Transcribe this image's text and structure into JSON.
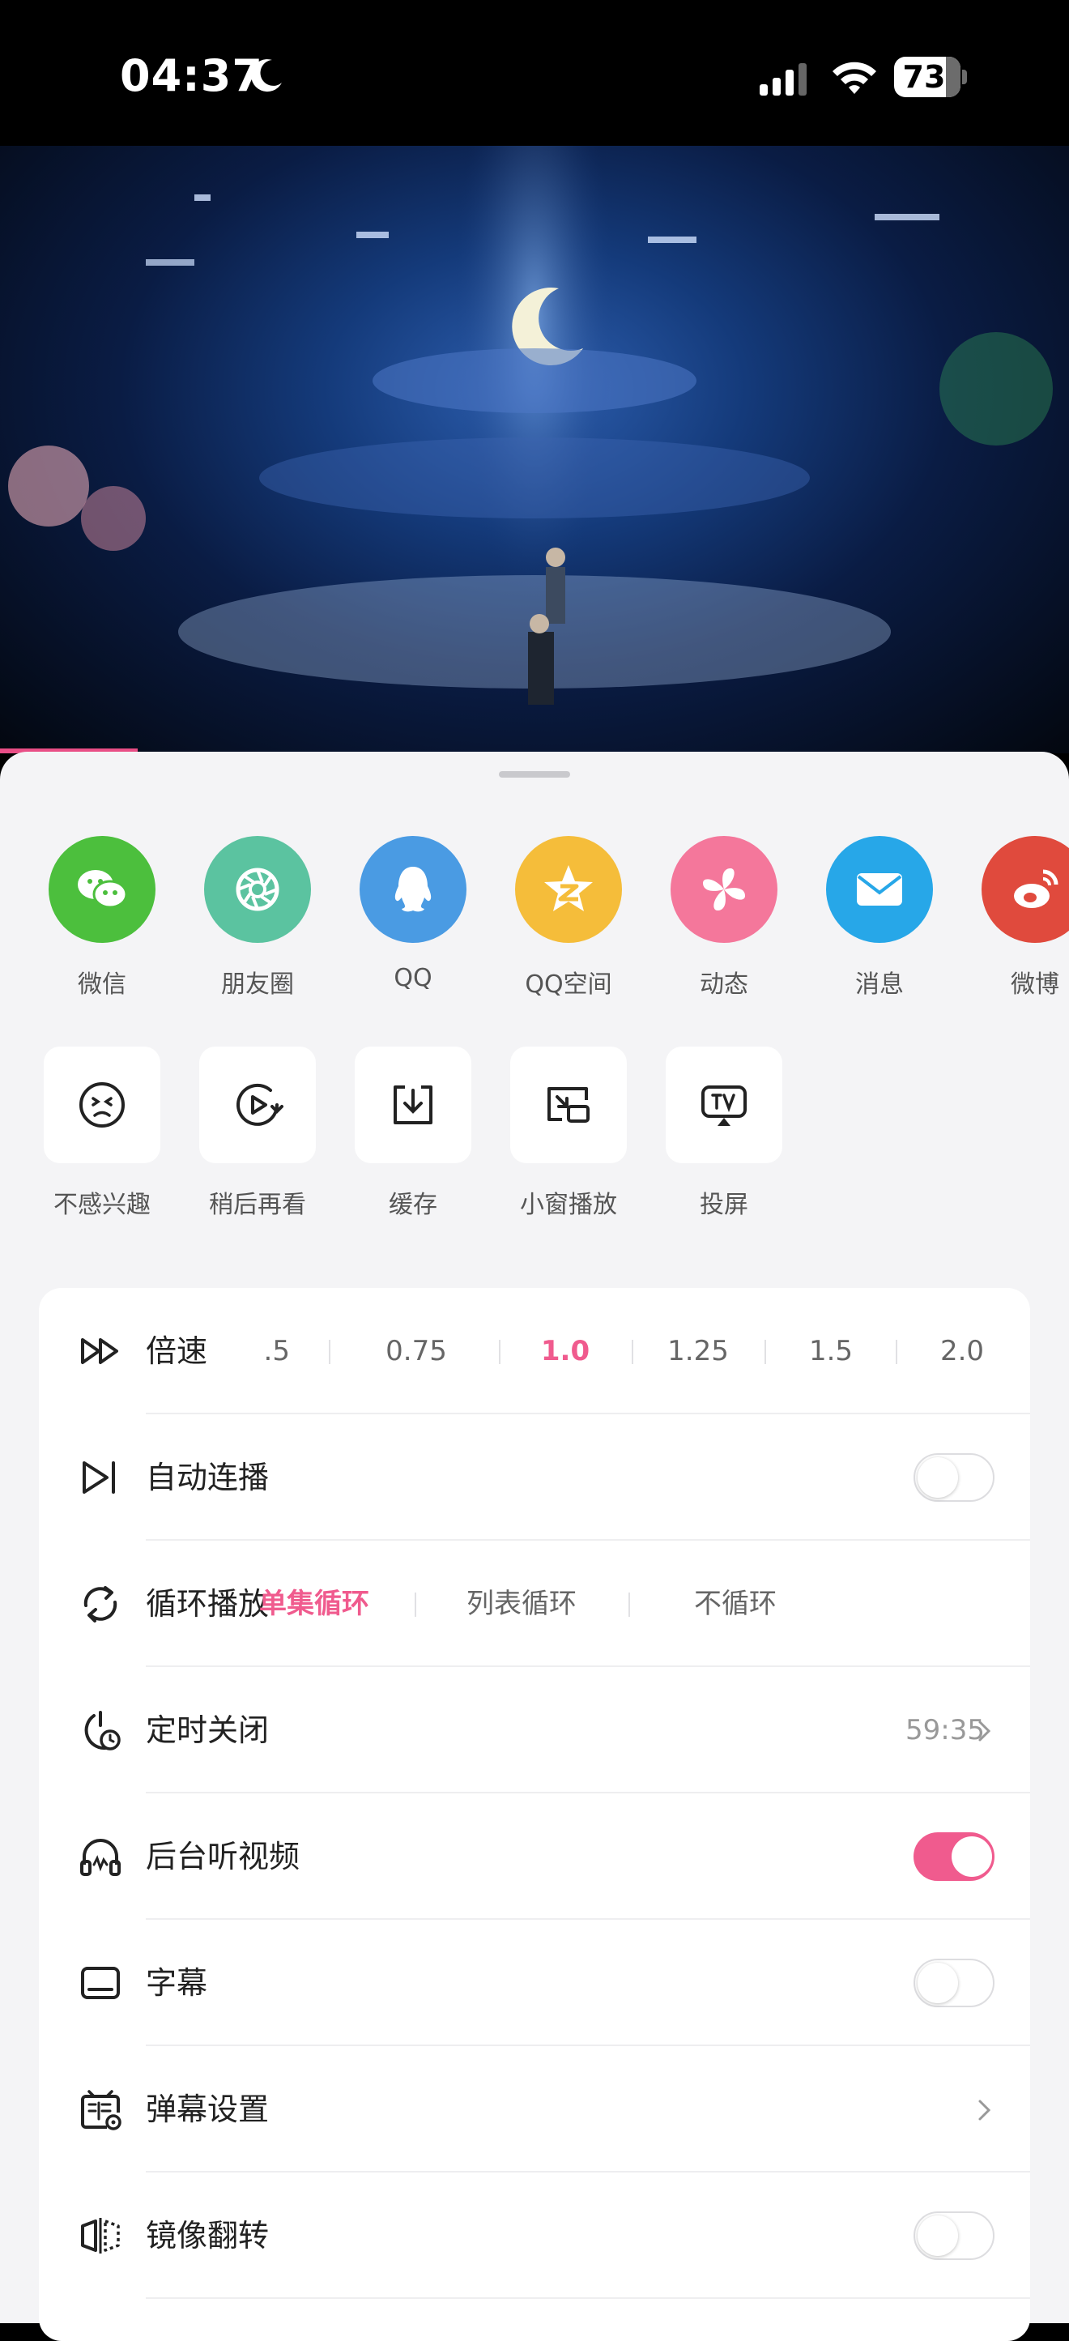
{
  "status_bar": {
    "time": "04:37",
    "battery": "73"
  },
  "share": [
    {
      "label": "微信",
      "icon": "wechat-icon",
      "color": "#4cbf3d"
    },
    {
      "label": "朋友圈",
      "icon": "moments-icon",
      "color": "#5bc3a0"
    },
    {
      "label": "QQ",
      "icon": "qq-icon",
      "color": "#4a9be3"
    },
    {
      "label": "QQ空间",
      "icon": "qzone-icon",
      "color": "#f5bd3a"
    },
    {
      "label": "动态",
      "icon": "pinwheel-icon",
      "color": "#f4779b"
    },
    {
      "label": "消息",
      "icon": "message-icon",
      "color": "#27a7e8"
    },
    {
      "label": "微博",
      "icon": "weibo-icon",
      "color": "#e04a3d"
    }
  ],
  "tools": [
    {
      "label": "不感兴趣",
      "icon": "not-interested-icon"
    },
    {
      "label": "稍后再看",
      "icon": "watch-later-icon"
    },
    {
      "label": "缓存",
      "icon": "download-icon"
    },
    {
      "label": "小窗播放",
      "icon": "mini-window-icon"
    },
    {
      "label": "投屏",
      "icon": "cast-tv-icon"
    }
  ],
  "settings": {
    "speed": {
      "title": "倍速",
      "options": [
        ".5",
        "0.75",
        "1.0",
        "1.25",
        "1.5",
        "2.0"
      ],
      "selected": "1.0"
    },
    "autoplay": {
      "title": "自动连播",
      "on": false
    },
    "loop": {
      "title": "循环播放",
      "options": [
        "单集循环",
        "列表循环",
        "不循环"
      ],
      "selected": "单集循环"
    },
    "timer": {
      "title": "定时关闭",
      "value": "59:35"
    },
    "background_audio": {
      "title": "后台听视频",
      "on": true
    },
    "subtitles": {
      "title": "字幕",
      "on": false
    },
    "danmaku": {
      "title": "弹幕设置"
    },
    "mirror": {
      "title": "镜像翻转",
      "on": false
    }
  },
  "colors": {
    "accent": "#f05b8e"
  }
}
